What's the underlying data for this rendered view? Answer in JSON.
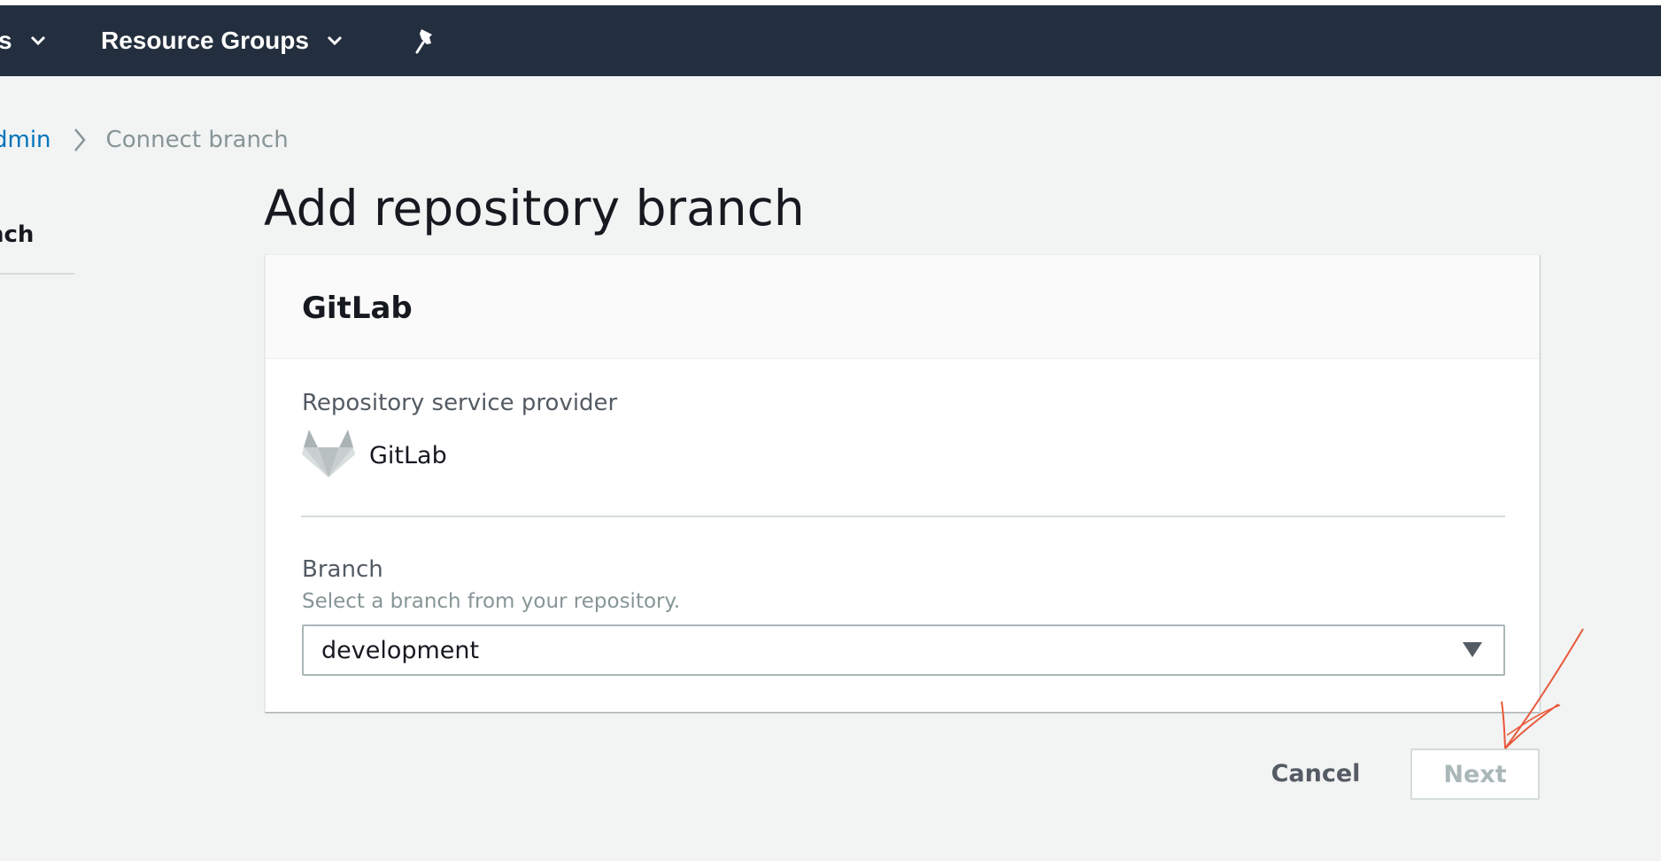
{
  "topnav": {
    "services_partial_label": "s",
    "resource_groups_label": "Resource Groups",
    "background_color": "#232f3e"
  },
  "breadcrumb": {
    "parent_partial_label": "dmin",
    "current_label": "Connect branch"
  },
  "side_nav": {
    "active_item_partial_label": "nch"
  },
  "page": {
    "title": "Add repository branch"
  },
  "panel": {
    "title": "GitLab",
    "provider": {
      "label": "Repository service provider",
      "name": "GitLab",
      "icon": "gitlab-logo-icon"
    },
    "branch": {
      "label": "Branch",
      "description": "Select a branch from your repository.",
      "selected_value": "development"
    }
  },
  "actions": {
    "cancel_label": "Cancel",
    "next_label": "Next",
    "next_disabled": true
  },
  "colors": {
    "link": "#0073bb",
    "annotation": "#e8583a",
    "text": "#16191f",
    "muted": "#879596"
  }
}
